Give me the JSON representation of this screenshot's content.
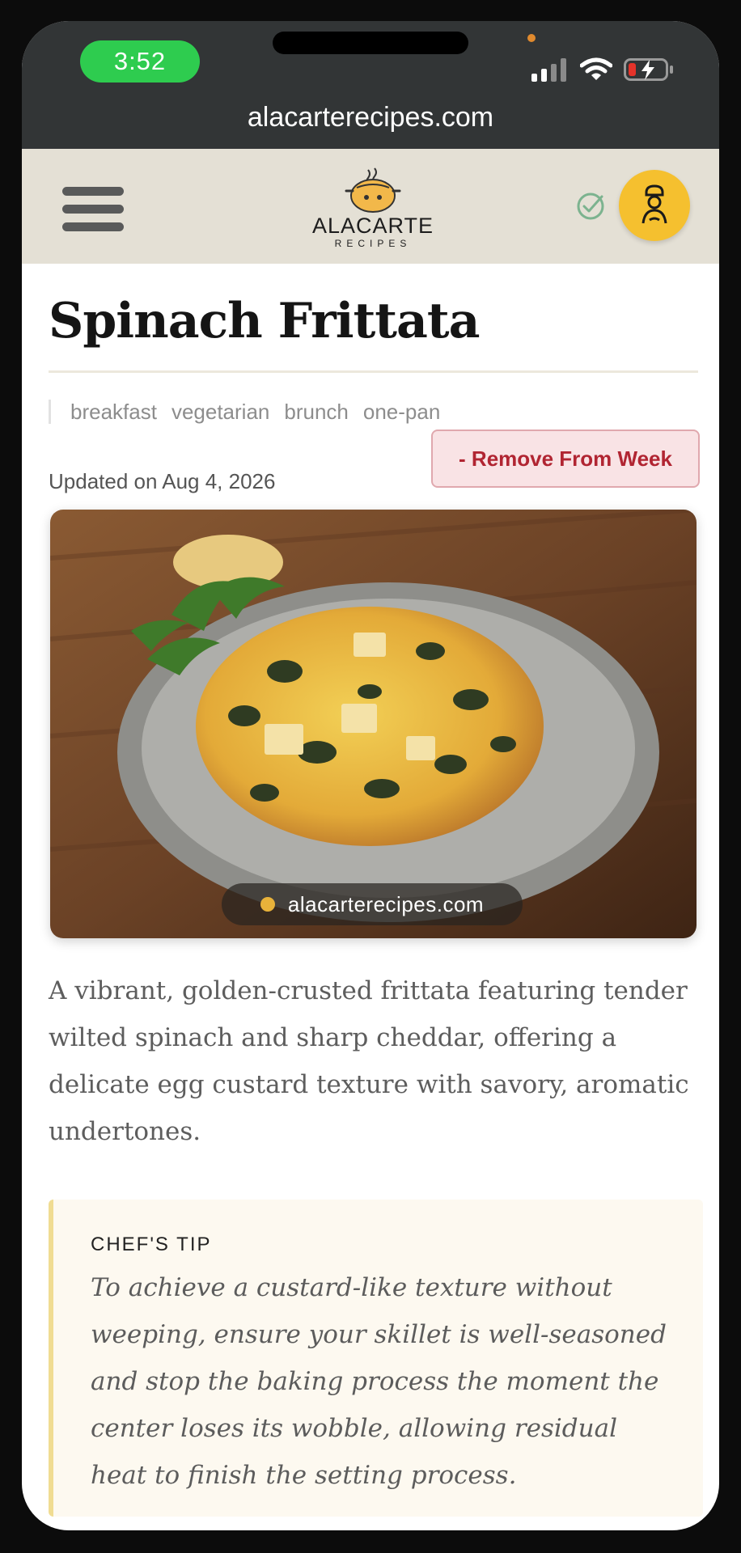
{
  "status_bar": {
    "time": "3:52",
    "icons": [
      "signal-icon",
      "wifi-icon",
      "battery-charging-icon"
    ]
  },
  "browser": {
    "url": "alacarterecipes.com"
  },
  "header": {
    "menu_icon": "hamburger-icon",
    "logo_word": "ALACARTE",
    "logo_sub": "RECIPES",
    "saved_icon": "check-circle-icon",
    "profile_icon": "chef-icon"
  },
  "recipe": {
    "title": "Spinach Frittata",
    "tags": [
      "breakfast",
      "vegetarian",
      "brunch",
      "one-pan"
    ],
    "updated": "Updated on Aug 4, 2026",
    "remove_label": "- Remove From Week",
    "watermark": "alacarterecipes.com",
    "description": "A vibrant, golden-crusted frittata featuring tender wilted spinach and sharp cheddar, offering a delicate egg custard texture with savory, aromatic undertones.",
    "tip_label": "CHEF'S TIP",
    "tip_text": "To achieve a custard-like texture without weeping, ensure your skillet is well-seasoned and stop the baking process the moment the center loses its wobble, allowing residual heat to finish the setting process."
  },
  "colors": {
    "status_pill": "#2ecc4f",
    "header_bg": "#e4e0d5",
    "accent_yellow": "#f5c02f",
    "remove_text": "#b12532",
    "remove_bg": "#f9e3e5",
    "tip_border": "#f0dc92"
  }
}
